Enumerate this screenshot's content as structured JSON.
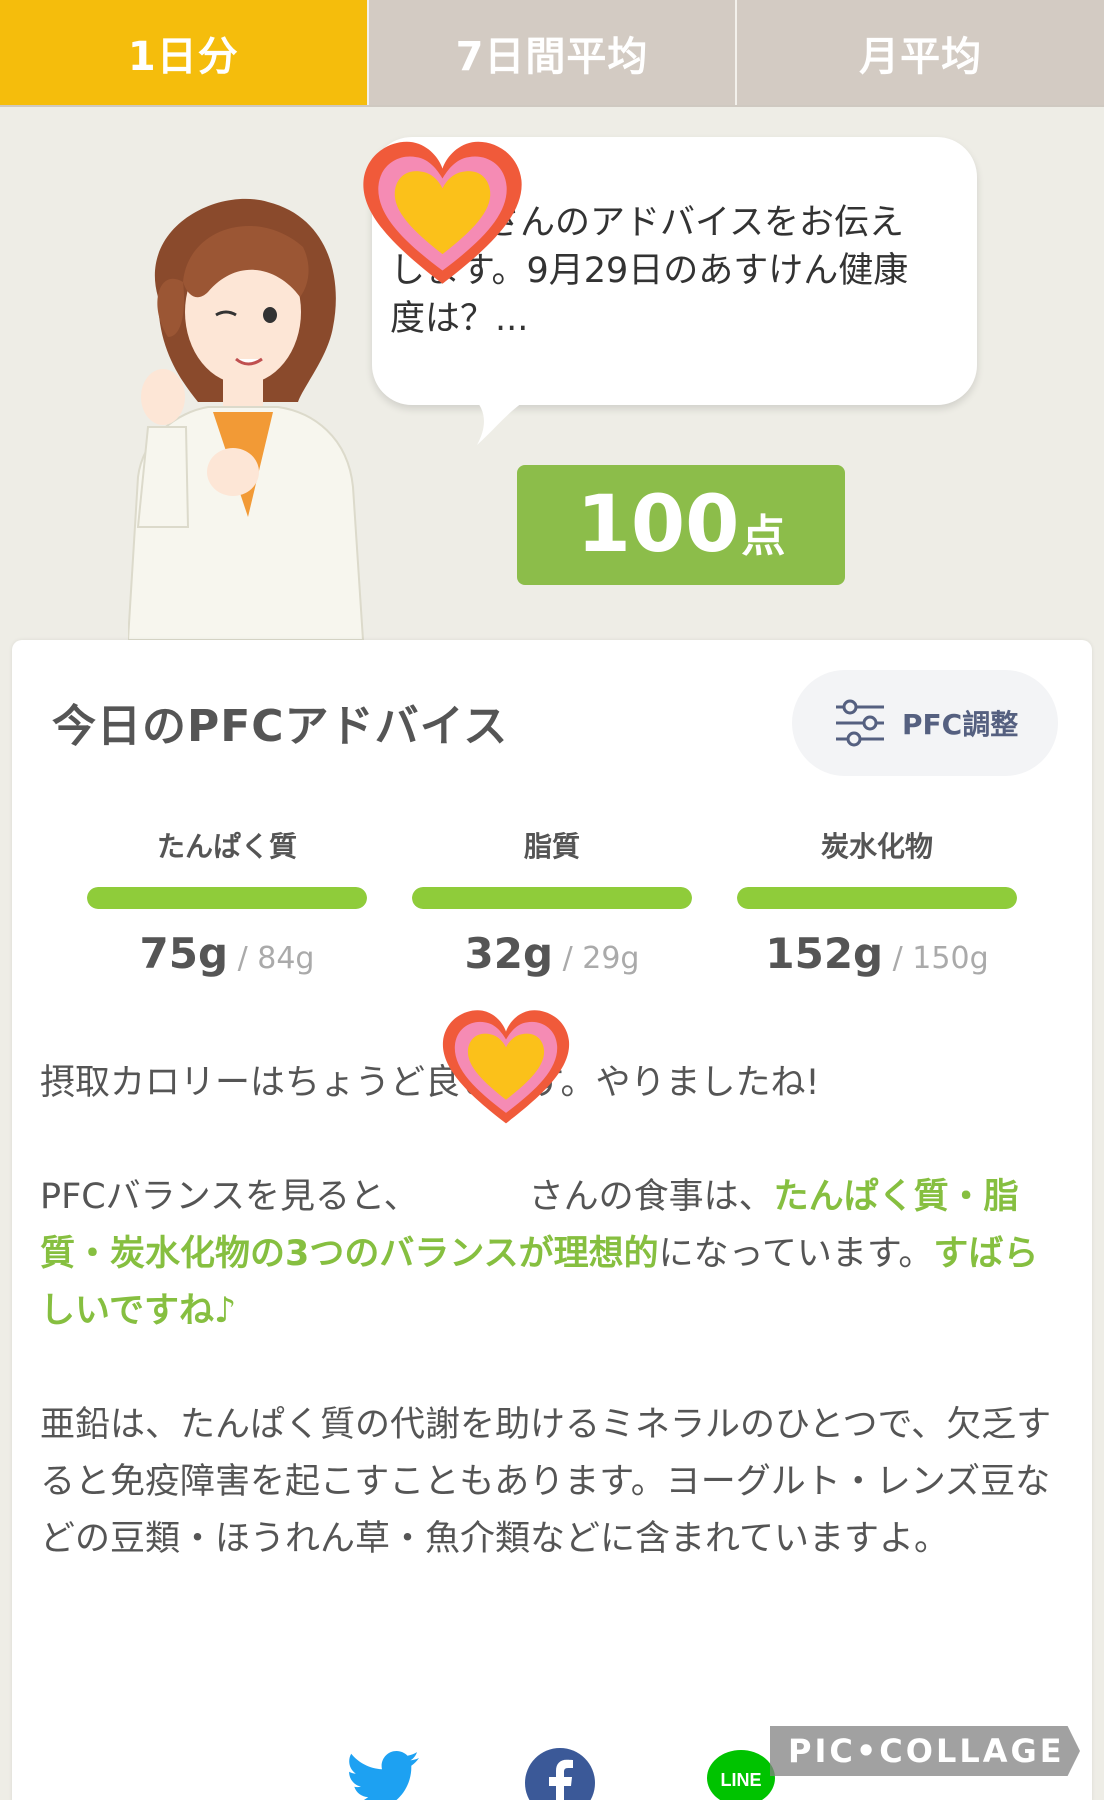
{
  "tabs": [
    {
      "label": "1日分",
      "active": true
    },
    {
      "label": "7日間平均",
      "active": false
    },
    {
      "label": "月平均",
      "active": false
    }
  ],
  "bubble": {
    "line1": "さんのアドバイスをお伝え",
    "line2": "します。9月29日のあすけん健康",
    "line3": "度は？..."
  },
  "score": {
    "value": "100",
    "unit": "点"
  },
  "card": {
    "title": "今日のPFCアドバイス",
    "pfc_button_label": "PFC調整"
  },
  "nutrients": [
    {
      "name": "たんぱく質",
      "value": "75g",
      "target": " / 84g",
      "fill_percent": 100
    },
    {
      "name": "脂質",
      "value": "32g",
      "target": " / 29g",
      "fill_percent": 100
    },
    {
      "name": "炭水化物",
      "value": "152g",
      "target": " / 150g",
      "fill_percent": 100
    }
  ],
  "advice": {
    "p1": "摂取カロリーはちょうど良いです。やりましたね!",
    "p2_a": "PFCバランスを見ると、",
    "p2_b": "さんの食事は、",
    "p2_hl1": "たんぱく質・脂質・炭水化物の3つのバランスが理想的",
    "p2_c": "になっています。",
    "p2_hl2": "すばらしいですね♪",
    "p3": "亜鉛は、たんぱく質の代謝を助けるミネラルのひとつで、欠乏すると免疫障害を起こすこともあります。ヨーグルト・レンズ豆などの豆類・ほうれん草・魚介類などに含まれていますよ。"
  },
  "share": {
    "icons": [
      "twitter-icon",
      "facebook-icon",
      "line-icon"
    ],
    "line_label": "LINE"
  },
  "watermark": "PIC•COLLAGE",
  "colors": {
    "active_tab": "#f5bd0c",
    "inactive_tab": "#d3cbc3",
    "score_bg": "#8cbd4a",
    "bar": "#8fcc3a",
    "highlight": "#86bf40"
  }
}
